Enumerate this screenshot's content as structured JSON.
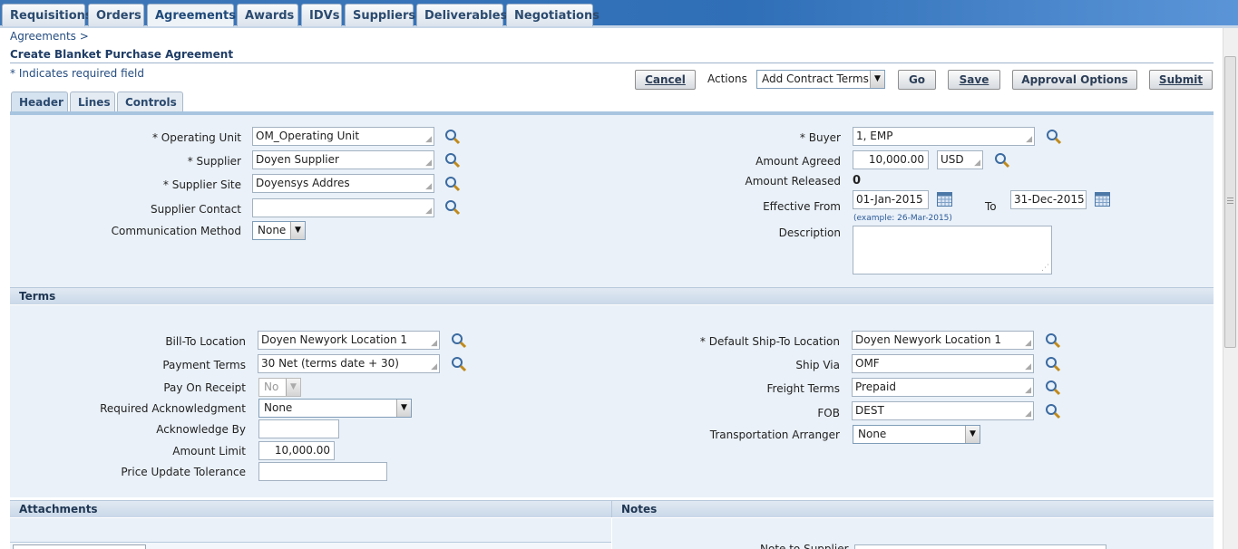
{
  "top_tabs": [
    "Requisitions",
    "Orders",
    "Agreements",
    "Awards",
    "IDVs",
    "Suppliers",
    "Deliverables",
    "Negotiations"
  ],
  "breadcrumb": "Agreements  >",
  "page_title": "Create Blanket Purchase Agreement",
  "required_note": "*  Indicates required field",
  "toolbar": {
    "cancel": "Cancel",
    "actions_label": "Actions",
    "actions_value": "Add Contract Terms",
    "go": "Go",
    "save": "Save",
    "approval": "Approval Options",
    "submit": "Submit"
  },
  "sub_tabs": [
    "Header",
    "Lines",
    "Controls"
  ],
  "header": {
    "operating_unit_label": "* Operating Unit",
    "operating_unit": "OM_Operating Unit",
    "supplier_label": "* Supplier",
    "supplier": "Doyen Supplier",
    "supplier_site_label": "* Supplier Site",
    "supplier_site": "Doyensys Addres",
    "supplier_contact_label": "Supplier Contact",
    "supplier_contact": "",
    "comm_method_label": "Communication Method",
    "comm_method": "None",
    "buyer_label": "* Buyer",
    "buyer": "1, EMP",
    "amount_agreed_label": "Amount Agreed",
    "amount_agreed": "10,000.00",
    "currency": "USD",
    "amount_released_label": "Amount Released",
    "amount_released": "0",
    "effective_from_label": "Effective From",
    "effective_from": "01-Jan-2015",
    "to_label": "To",
    "effective_to": "31-Dec-2015",
    "date_example": "(example: 26-Mar-2015)",
    "description_label": "Description"
  },
  "terms": {
    "title": "Terms",
    "bill_to_label": "Bill-To Location",
    "bill_to": "Doyen Newyork Location 1",
    "payment_terms_label": "Payment Terms",
    "payment_terms": "30 Net (terms date + 30)",
    "pay_on_receipt_label": "Pay On Receipt",
    "pay_on_receipt": "No",
    "req_ack_label": "Required Acknowledgment",
    "req_ack": "None",
    "ack_by_label": "Acknowledge By",
    "ack_by": "",
    "amount_limit_label": "Amount Limit",
    "amount_limit": "10,000.00",
    "price_tol_label": "Price Update Tolerance",
    "price_tol": "",
    "ship_to_label": "* Default Ship-To Location",
    "ship_to": "Doyen Newyork Location 1",
    "ship_via_label": "Ship Via",
    "ship_via": "OMF",
    "freight_label": "Freight Terms",
    "freight": "Prepaid",
    "fob_label": "FOB",
    "fob": "DEST",
    "transport_label": "Transportation Arranger",
    "transport": "None"
  },
  "attachments_title": "Attachments",
  "notes_title": "Notes",
  "notes_partial_label": "Note to Supplier",
  "colors": {
    "accent": "#2f6fb7",
    "panel": "#eaf1f8",
    "link": "#254d80"
  }
}
